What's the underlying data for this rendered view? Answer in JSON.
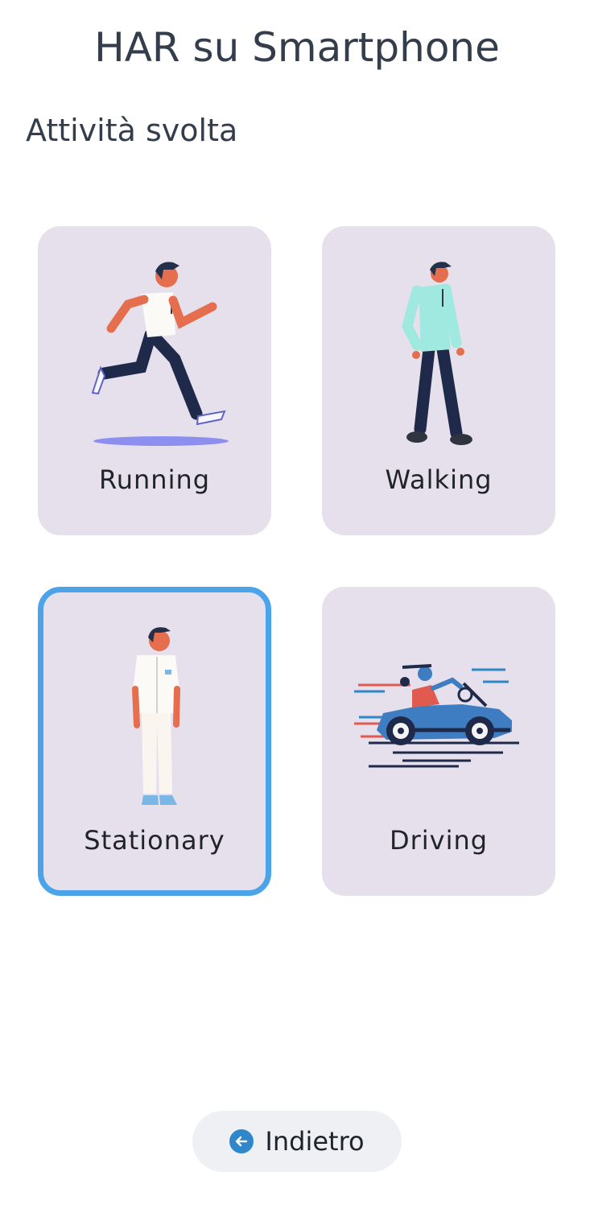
{
  "header": {
    "title": "HAR su Smartphone"
  },
  "section": {
    "title": "Attività svolta"
  },
  "activities": [
    {
      "label": "Running",
      "icon": "running-person-icon",
      "selected": false
    },
    {
      "label": "Walking",
      "icon": "walking-person-icon",
      "selected": false
    },
    {
      "label": "Stationary",
      "icon": "standing-person-icon",
      "selected": true
    },
    {
      "label": "Driving",
      "icon": "driving-car-icon",
      "selected": false
    }
  ],
  "footer": {
    "back_label": "Indietro",
    "back_icon": "arrow-left-circle-icon"
  },
  "colors": {
    "card_background": "#e6e0ec",
    "selected_border": "#4ba3ea",
    "back_icon": "#2f86c8",
    "back_button_background": "#eef0f3"
  }
}
